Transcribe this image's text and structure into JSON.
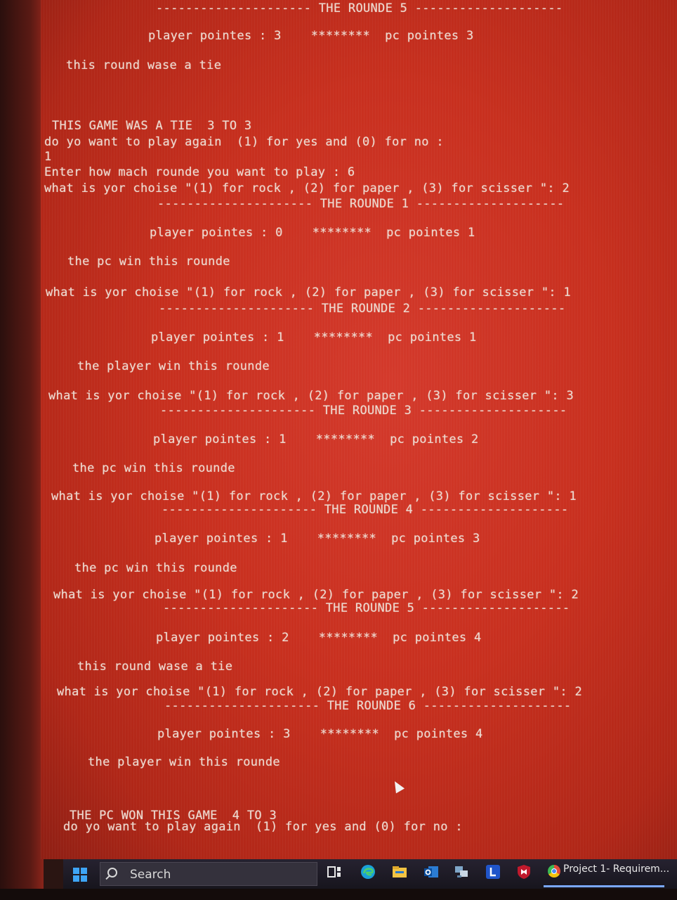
{
  "console": {
    "lines": [
      "--------------------- THE ROUNDE 5 --------------------",
      "player pointes : 3    ********  pc pointes 3",
      "this round wase a tie",
      "THIS GAME WAS A TIE  3 TO 3",
      "do yo want to play again  (1) for yes and (0) for no :",
      "1",
      "Enter how mach rounde you want to play : 6",
      "what is yor choise \"(1) for rock , (2) for paper , (3) for scisser \": 2",
      "--------------------- THE ROUNDE 1 --------------------",
      "player pointes : 0    ********  pc pointes 1",
      "the pc win this rounde",
      "what is yor choise \"(1) for rock , (2) for paper , (3) for scisser \": 1",
      "--------------------- THE ROUNDE 2 --------------------",
      "player pointes : 1    ********  pc pointes 1",
      "the player win this rounde",
      "what is yor choise \"(1) for rock , (2) for paper , (3) for scisser \": 3",
      "--------------------- THE ROUNDE 3 --------------------",
      "player pointes : 1    ********  pc pointes 2",
      "the pc win this rounde",
      "what is yor choise \"(1) for rock , (2) for paper , (3) for scisser \": 1",
      "--------------------- THE ROUNDE 4 --------------------",
      "player pointes : 1    ********  pc pointes 3",
      "the pc win this rounde",
      "what is yor choise \"(1) for rock , (2) for paper , (3) for scisser \": 2",
      "--------------------- THE ROUNDE 5 --------------------",
      "player pointes : 2    ********  pc pointes 4",
      "this round wase a tie",
      "what is yor choise \"(1) for rock , (2) for paper , (3) for scisser \": 2",
      "--------------------- THE ROUNDE 6 --------------------",
      "player pointes : 3    ********  pc pointes 4",
      "the player win this rounde",
      "THE PC WON THIS GAME  4 TO 3",
      "do yo want to play again  (1) for yes and (0) for no :"
    ]
  },
  "taskbar": {
    "search_label": "Search",
    "active_app_label": "Project 1- Requirem...",
    "icons": [
      "windows-start",
      "search",
      "task-view",
      "edge",
      "file-explorer",
      "outlook",
      "network-app",
      "l-app",
      "mcafee",
      "chrome"
    ]
  },
  "colors": {
    "screen_bg": "#c8301f",
    "console_text": "#ecd9cf",
    "taskbar_bg": "#1d1a24"
  }
}
